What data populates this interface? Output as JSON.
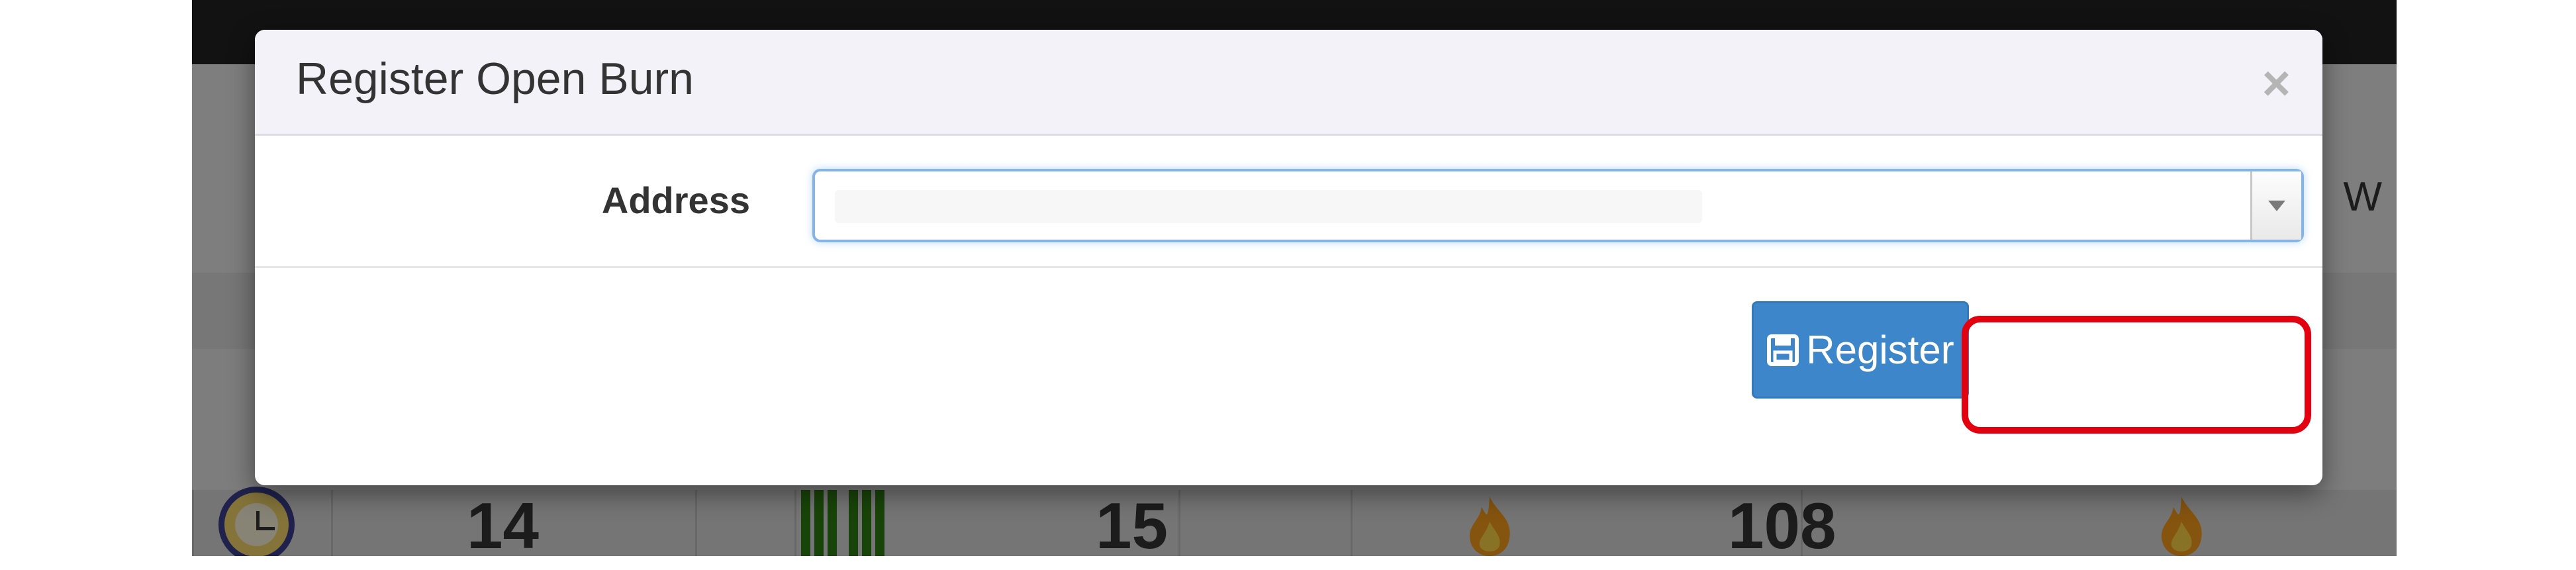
{
  "background": {
    "side_letter": "W",
    "stats": [
      "14",
      "15",
      "108"
    ],
    "icons": [
      "alarm-clock-icon",
      "green-bars-icon",
      "flame-icon",
      "flame-icon"
    ]
  },
  "modal": {
    "title": "Register Open Burn",
    "close_label": "×",
    "address_label": "Address",
    "address_value": "",
    "register_label": "Register",
    "register_icon": "save-icon"
  },
  "colors": {
    "primary_button": "#3d86c9",
    "highlight": "#e3000f",
    "focus_border": "#86b4e6"
  }
}
